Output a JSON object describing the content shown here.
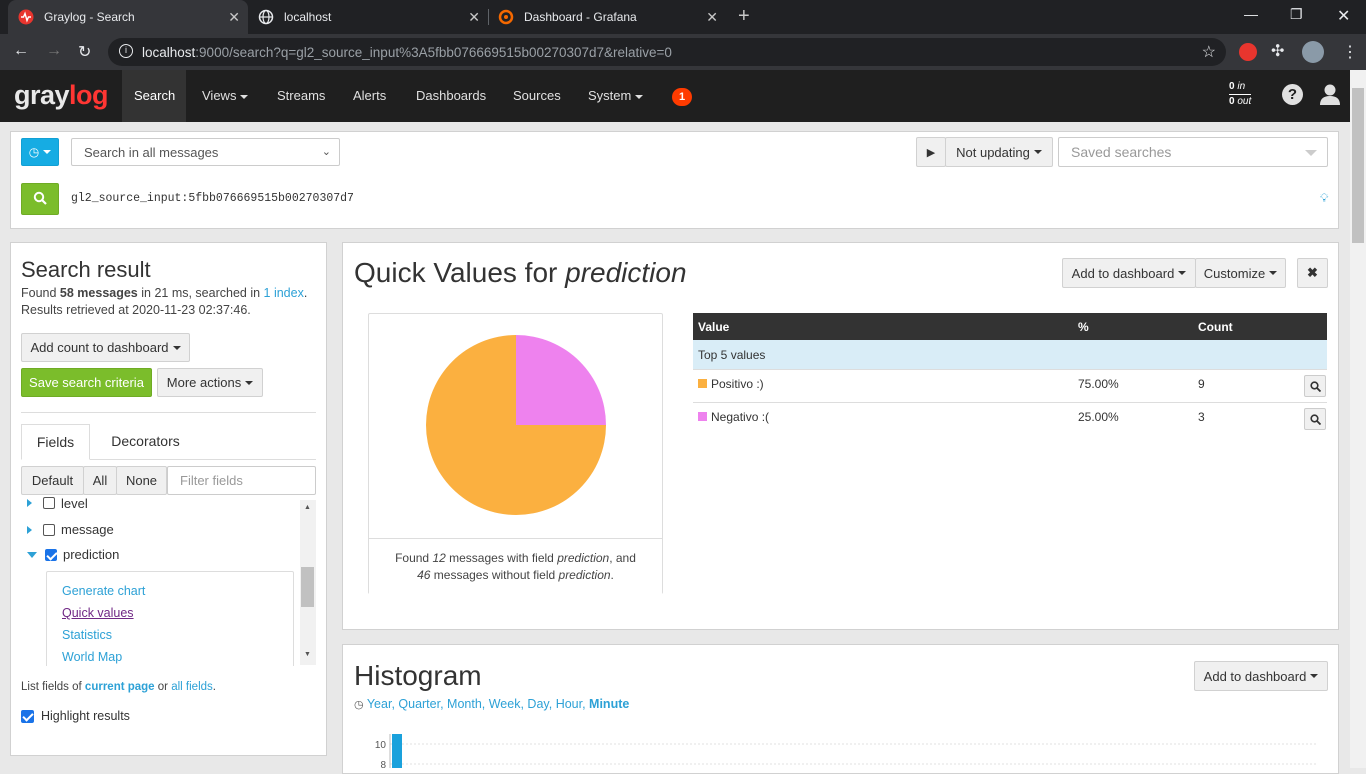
{
  "browser": {
    "tabs": [
      {
        "title": "Graylog - Search",
        "icon": "graylog-icon"
      },
      {
        "title": "localhost",
        "icon": "globe-icon"
      },
      {
        "title": "Dashboard - Grafana",
        "icon": "grafana-icon"
      }
    ],
    "url_host": "localhost",
    "url_rest": ":9000/search?q=gl2_source_input%3A5fbb076669515b00270307d7&relative=0"
  },
  "nav": {
    "logo_a": "gray",
    "logo_b": "log",
    "items": [
      "Search",
      "Views",
      "Streams",
      "Alerts",
      "Dashboards",
      "Sources",
      "System"
    ],
    "notifications": "1",
    "throughput_in_value": "0",
    "throughput_in_label": "in",
    "throughput_out_value": "0",
    "throughput_out_label": "out"
  },
  "search": {
    "range_placeholder": "Search in all messages",
    "update_state": "Not updating",
    "saved_searches_placeholder": "Saved searches",
    "query": "gl2_source_input:5fbb076669515b00270307d7"
  },
  "sidebar": {
    "title": "Search result",
    "found_prefix": "Found ",
    "found_count": "58 messages",
    "found_mid": " in 21 ms, searched in ",
    "found_index": "1 index",
    "found_end": ".",
    "retrieved": "Results retrieved at 2020-11-23 02:37:46.",
    "add_count_label": "Add count to dashboard",
    "save_criteria_label": "Save search criteria",
    "more_actions_label": "More actions",
    "tab_fields": "Fields",
    "tab_decorators": "Decorators",
    "filter_buttons": [
      "Default",
      "All",
      "None"
    ],
    "filter_placeholder": "Filter fields",
    "fields": [
      {
        "name": "level",
        "checked": false
      },
      {
        "name": "message",
        "checked": false
      },
      {
        "name": "prediction",
        "checked": true
      }
    ],
    "field_actions": [
      "Generate chart",
      "Quick values",
      "Statistics",
      "World Map"
    ],
    "list_fields_prefix": "List fields of ",
    "list_fields_current": "current page",
    "list_fields_or": " or ",
    "list_fields_all": "all fields",
    "list_fields_end": ".",
    "highlight_label": "Highlight results"
  },
  "quick_values": {
    "title_prefix": "Quick Values for ",
    "field": "prediction",
    "add_to_dashboard": "Add to dashboard",
    "customize": "Customize",
    "footer_a": "Found ",
    "footer_with": "12",
    "footer_b": " messages with field ",
    "footer_field": "prediction",
    "footer_c": ", and",
    "footer_without": "46",
    "footer_d": " messages without field ",
    "footer_field2": "prediction",
    "footer_e": ".",
    "table": {
      "headers": [
        "Value",
        "%",
        "Count"
      ],
      "group_label": "Top 5 values",
      "rows": [
        {
          "value": "Positivo :)",
          "percent": "75.00%",
          "count": "9",
          "color": "#fbb040"
        },
        {
          "value": "Negativo :(",
          "percent": "25.00%",
          "count": "3",
          "color": "#ee82ee"
        }
      ]
    }
  },
  "chart_data": [
    {
      "type": "pie",
      "categories": [
        "Positivo :)",
        "Negativo :("
      ],
      "values": [
        9,
        3
      ],
      "colors": [
        "#fbb040",
        "#ee82ee"
      ]
    },
    {
      "type": "bar",
      "y_ticks": [
        "10",
        "8"
      ]
    }
  ],
  "histogram": {
    "title": "Histogram",
    "add_to_dashboard": "Add to dashboard",
    "resolutions": [
      "Year",
      "Quarter",
      "Month",
      "Week",
      "Day",
      "Hour",
      "Minute"
    ],
    "active_resolution": "Minute"
  }
}
